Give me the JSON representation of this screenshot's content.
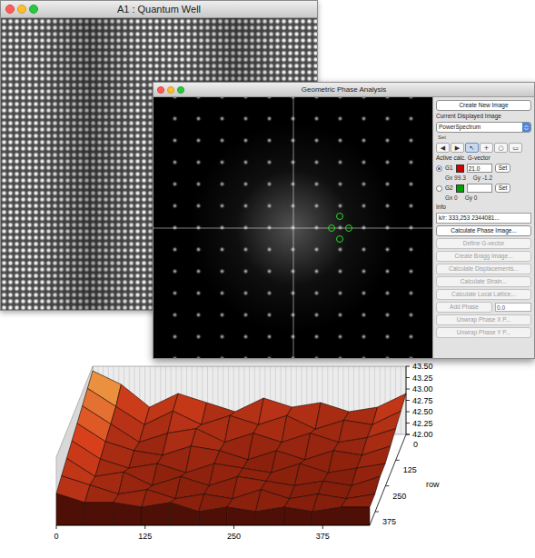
{
  "image_window": {
    "title": "A1 : Quantum Well"
  },
  "gpa_window": {
    "title": "Geometric Phase Analysis",
    "panel": {
      "create_button": "Create New Image",
      "displayed_label": "Current Displayed Image",
      "displayed_value": "PowerSpectrum",
      "tool_label": "Set",
      "tools": [
        {
          "glyph": "◀",
          "selected": false
        },
        {
          "glyph": "▶",
          "selected": false
        },
        {
          "glyph": "↖",
          "selected": true
        },
        {
          "glyph": "+",
          "selected": false
        },
        {
          "glyph": "○",
          "selected": false
        },
        {
          "glyph": "▭",
          "selected": false
        }
      ],
      "gvector_label": "Active calc. G-vector",
      "gvectors": [
        {
          "label": "G1",
          "selected": true,
          "color": "#d40000",
          "value": "21.0",
          "set": "Set",
          "gx": "Gx 99.3",
          "gy": "Gy -1.2"
        },
        {
          "label": "G2",
          "selected": false,
          "color": "#00a000",
          "value": "",
          "set": "Set",
          "gx": "Gx 0",
          "gy": "Gy 0"
        }
      ],
      "info_label": "Info",
      "info_value": "k/r: 333,253  2344081...",
      "actions": [
        {
          "kind": "button",
          "label": "Calculate Phase Image...",
          "disabled": false
        },
        {
          "kind": "button",
          "label": "Define G-vector",
          "disabled": true
        },
        {
          "kind": "button",
          "label": "Create Bragg Image...",
          "disabled": true
        },
        {
          "kind": "button",
          "label": "Calculate Displacements...",
          "disabled": true
        },
        {
          "kind": "button",
          "label": "Calculate Strain...",
          "disabled": true
        },
        {
          "kind": "button",
          "label": "Calculate Local Lattice...",
          "disabled": true
        },
        {
          "kind": "field",
          "label": "Add Phase",
          "disabled": true,
          "value": "0.0"
        },
        {
          "kind": "button",
          "label": "Unwrap Phase X P...",
          "disabled": true
        },
        {
          "kind": "button",
          "label": "Unwrap Phase Y P...",
          "disabled": true
        }
      ]
    }
  },
  "surface_plot": {
    "z_ticks": [
      "43.50",
      "43.25",
      "43.00",
      "42.75",
      "42.50",
      "42.25",
      "42.00"
    ],
    "z_range": [
      42.0,
      43.5
    ],
    "row_ticks": [
      "0",
      "125",
      "250",
      "375"
    ],
    "row_title": "row",
    "col_ticks": [
      "0",
      "125",
      "250",
      "375"
    ],
    "heights": [
      [
        43.4,
        43.1,
        42.6,
        42.9,
        42.7,
        42.5,
        42.8,
        42.6,
        42.7,
        42.5,
        42.6,
        42.9
      ],
      [
        43.3,
        42.9,
        42.5,
        42.8,
        42.5,
        42.7,
        42.5,
        42.7,
        42.4,
        42.6,
        42.5,
        42.8
      ],
      [
        43.2,
        42.8,
        42.4,
        42.6,
        42.7,
        42.4,
        42.6,
        42.4,
        42.6,
        42.4,
        42.5,
        42.7
      ],
      [
        43.1,
        42.7,
        42.5,
        42.4,
        42.6,
        42.5,
        42.3,
        42.5,
        42.3,
        42.5,
        42.4,
        42.6
      ],
      [
        43.0,
        42.6,
        42.4,
        42.5,
        42.3,
        42.5,
        42.4,
        42.3,
        42.5,
        42.3,
        42.4,
        42.5
      ],
      [
        42.9,
        42.5,
        42.6,
        42.3,
        42.5,
        42.3,
        42.5,
        42.4,
        42.3,
        42.4,
        42.3,
        42.5
      ],
      [
        42.8,
        42.6,
        42.4,
        42.5,
        42.3,
        42.4,
        42.3,
        42.5,
        42.3,
        42.4,
        42.3,
        42.4
      ],
      [
        42.7,
        42.5,
        42.5,
        42.4,
        42.5,
        42.3,
        42.4,
        42.3,
        42.4,
        42.3,
        42.4,
        42.4
      ]
    ]
  }
}
